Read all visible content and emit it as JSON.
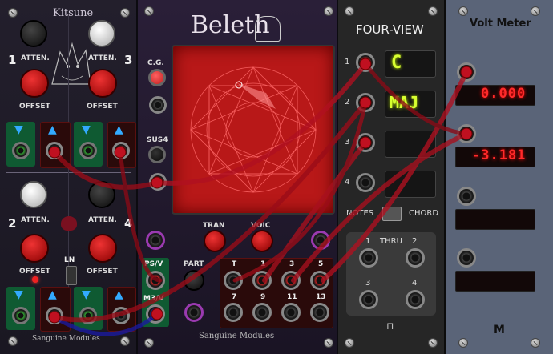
{
  "kitsune": {
    "title": "Kitsune",
    "channels": [
      "1",
      "3",
      "2",
      "4"
    ],
    "atten_label": "ATTEN.",
    "offset_label": "OFFSET",
    "ln_label": "LN",
    "brand": "Sanguine Modules"
  },
  "beleth": {
    "title": "Beleth",
    "cg_label": "C.G.",
    "sus4_label": "SUS4",
    "tran_label": "TRAN",
    "voic_label": "VOIC",
    "psv_label": "PS/V",
    "m3v_label": "M3/V",
    "part_label": "PART",
    "ext_labels": [
      "T",
      "1",
      "3",
      "5",
      "7",
      "9",
      "11",
      "13"
    ],
    "brand": "Sanguine Modules"
  },
  "fourview": {
    "title": "FOUR-VIEW",
    "rows": [
      "1",
      "2",
      "3",
      "4"
    ],
    "displays": [
      "C",
      "MAJ",
      "",
      ""
    ],
    "notes_label": "NOTES",
    "chord_label": "CHORD",
    "thru_label": "THRU",
    "thru_nums": [
      "1",
      "2",
      "3",
      "4"
    ]
  },
  "voltmeter": {
    "title": "Volt Meter",
    "readings": [
      "0.000",
      "-3.181",
      "",
      ""
    ],
    "logo": "M"
  },
  "colors": {
    "accent_red": "#d01820",
    "panel_dark": "#1c1a26",
    "display_green": "#d8ff30",
    "display_red": "#ff2a2a"
  }
}
